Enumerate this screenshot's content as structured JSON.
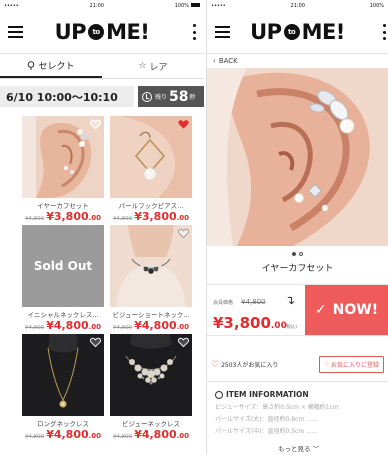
{
  "status": {
    "carrier": "•••••",
    "time": "21:00",
    "battery": "100%"
  },
  "app": {
    "logo_left": "UP",
    "logo_mid": "to",
    "logo_right": "ME!"
  },
  "left": {
    "tabs": [
      {
        "label": "セレクト",
        "icon": "pin-icon",
        "active": true
      },
      {
        "label": "レア",
        "icon": "star-icon",
        "active": false
      }
    ],
    "timer": {
      "range": "6/10 10:00〜10:10",
      "remain_label": "残り",
      "remain_value": "58",
      "remain_unit": "秒"
    },
    "products": [
      {
        "name": "イヤーカフセット",
        "orig": "¥4,800",
        "price": "¥3,800",
        "cents": ".00",
        "fav": false,
        "kind": "ear"
      },
      {
        "name": "パールフックピアス...",
        "orig": "¥4,800",
        "price": "¥3,800",
        "cents": ".00",
        "fav": true,
        "kind": "pearl"
      },
      {
        "name": "イニシャルネックレス...",
        "orig": "¥4,800",
        "price": "¥4,800",
        "cents": ".00",
        "fav": false,
        "kind": "soldout",
        "overlay": "Sold Out"
      },
      {
        "name": "ビジューショートネック...",
        "orig": "¥4,800",
        "price": "¥4,800",
        "cents": ".00",
        "fav": false,
        "kind": "choker"
      },
      {
        "name": "ロングネックレス",
        "orig": "¥4,800",
        "price": "¥4,800",
        "cents": ".00",
        "fav": false,
        "kind": "long"
      },
      {
        "name": "ビジューネックレス",
        "orig": "¥4,800",
        "price": "¥4,800",
        "cents": ".00",
        "fav": false,
        "kind": "bijou"
      }
    ]
  },
  "right": {
    "back_label": "BACK",
    "title": "イヤーカフセット",
    "price_label": "会員価格",
    "orig": "¥4,800",
    "price": "¥3,800",
    "cents": ".00",
    "tax": "(税込)",
    "now_label": "NOW!",
    "fav_count": "2503人がお気に入り",
    "fav_button": "お気に入りに登録",
    "info_title": "ITEM INFORMATION",
    "info_lines": [
      "ビジューサイズ：高さ約0.5cm × 横幅約1cm",
      "パールサイズ(大)：直径約0.8cm ......",
      "パールサイズ(中)：直径約0.5cm ......"
    ],
    "more_label": "もっと見る"
  }
}
